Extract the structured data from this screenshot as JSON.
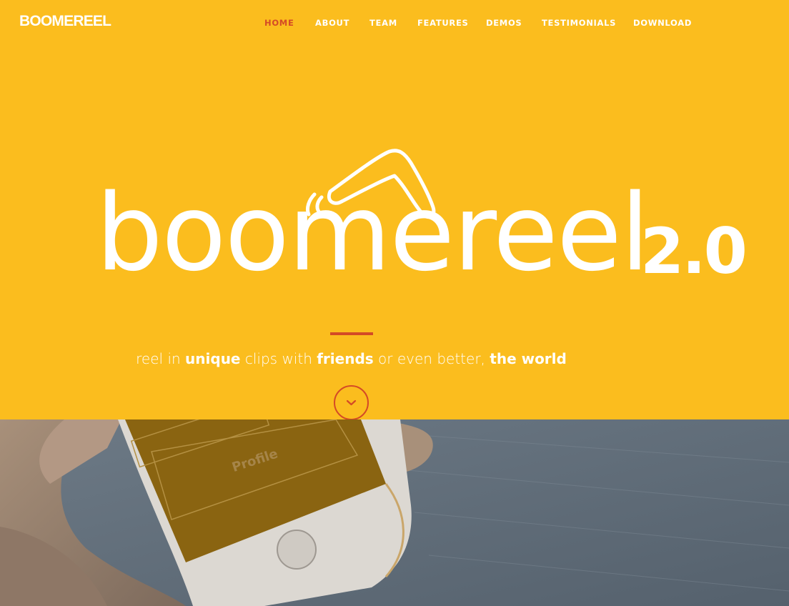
{
  "brand": "BOOMEREEL",
  "nav": {
    "items": [
      {
        "label": "HOME",
        "active": true
      },
      {
        "label": "ABOUT"
      },
      {
        "label": "TEAM"
      },
      {
        "label": "FEATURES"
      },
      {
        "label": "DEMOS"
      },
      {
        "label": "TESTIMONIALS"
      },
      {
        "label": "DOWNLOAD"
      }
    ]
  },
  "hero": {
    "wordmark": "boomereel",
    "version": "2.0",
    "tagline": {
      "p1": "reel in ",
      "b1": "unique",
      "p2": " clips with ",
      "b2": "friends",
      "p3": " or even better, ",
      "b3": "the world"
    },
    "scroll_icon": "chevron-down-icon"
  },
  "photo": {
    "screen_label": "Profile"
  },
  "colors": {
    "background": "#fbbd1e",
    "accent": "#d44a26",
    "text": "#ffffff"
  }
}
